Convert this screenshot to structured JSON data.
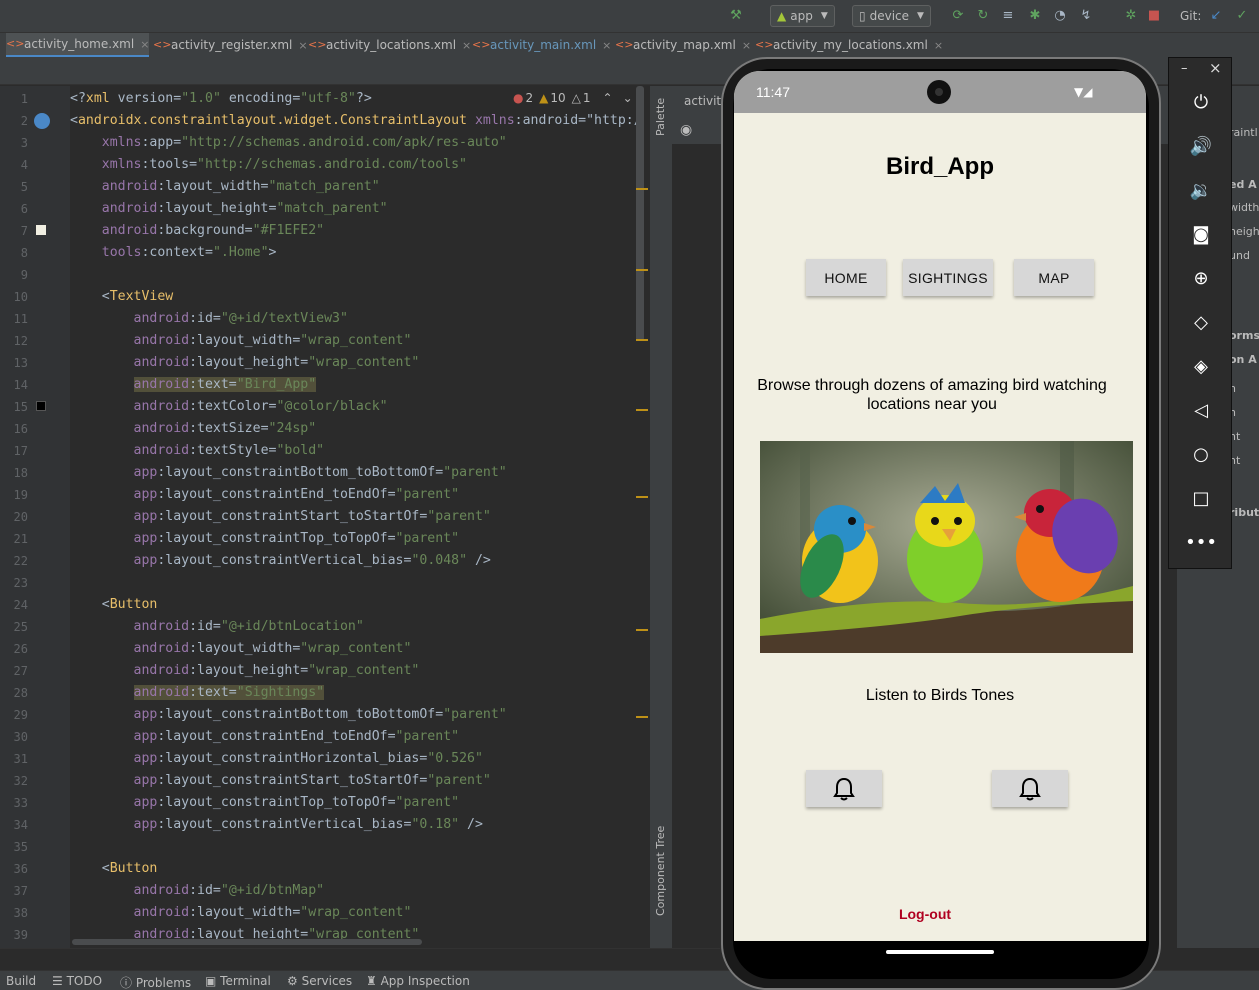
{
  "toolbar": {
    "run_config": "app",
    "device": "device",
    "git_label": "Git:"
  },
  "tabs": [
    {
      "label": "activity_home.xml",
      "active": true
    },
    {
      "label": "activity_register.xml",
      "active": false
    },
    {
      "label": "activity_locations.xml",
      "active": false
    },
    {
      "label": "activity_main.xml",
      "active": false
    },
    {
      "label": "activity_map.xml",
      "active": false
    },
    {
      "label": "activity_my_locations.xml",
      "active": false
    }
  ],
  "inspection": {
    "errors": "2",
    "warnings": "10",
    "weak_warnings": "1"
  },
  "side_panels": {
    "palette": "Palette",
    "component_tree": "Component Tree"
  },
  "right_panel": {
    "tab_label": "activity",
    "attr_fragments": [
      "ed A",
      "width",
      "heigh",
      "und",
      "orms",
      "on A",
      "h",
      "h",
      "nt",
      "nt",
      "ribute"
    ],
    "top_fragment": "raintl"
  },
  "code_lines": [
    {
      "n": "1",
      "text": "<?xml version=\"1.0\" encoding=\"utf-8\"?>"
    },
    {
      "n": "2",
      "text": "<androidx.constraintlayout.widget.ConstraintLayout xmlns:android=\"http:/"
    },
    {
      "n": "3",
      "text": "    xmlns:app=\"http://schemas.android.com/apk/res-auto\""
    },
    {
      "n": "4",
      "text": "    xmlns:tools=\"http://schemas.android.com/tools\""
    },
    {
      "n": "5",
      "text": "    android:layout_width=\"match_parent\""
    },
    {
      "n": "6",
      "text": "    android:layout_height=\"match_parent\""
    },
    {
      "n": "7",
      "text": "    android:background=\"#F1EFE2\""
    },
    {
      "n": "8",
      "text": "    tools:context=\".Home\">"
    },
    {
      "n": "9",
      "text": ""
    },
    {
      "n": "10",
      "text": "    <TextView"
    },
    {
      "n": "11",
      "text": "        android:id=\"@+id/textView3\""
    },
    {
      "n": "12",
      "text": "        android:layout_width=\"wrap_content\""
    },
    {
      "n": "13",
      "text": "        android:layout_height=\"wrap_content\""
    },
    {
      "n": "14",
      "text": "        android:text=\"Bird_App\""
    },
    {
      "n": "15",
      "text": "        android:textColor=\"@color/black\""
    },
    {
      "n": "16",
      "text": "        android:textSize=\"24sp\""
    },
    {
      "n": "17",
      "text": "        android:textStyle=\"bold\""
    },
    {
      "n": "18",
      "text": "        app:layout_constraintBottom_toBottomOf=\"parent\""
    },
    {
      "n": "19",
      "text": "        app:layout_constraintEnd_toEndOf=\"parent\""
    },
    {
      "n": "20",
      "text": "        app:layout_constraintStart_toStartOf=\"parent\""
    },
    {
      "n": "21",
      "text": "        app:layout_constraintTop_toTopOf=\"parent\""
    },
    {
      "n": "22",
      "text": "        app:layout_constraintVertical_bias=\"0.048\" />"
    },
    {
      "n": "23",
      "text": ""
    },
    {
      "n": "24",
      "text": "    <Button"
    },
    {
      "n": "25",
      "text": "        android:id=\"@+id/btnLocation\""
    },
    {
      "n": "26",
      "text": "        android:layout_width=\"wrap_content\""
    },
    {
      "n": "27",
      "text": "        android:layout_height=\"wrap_content\""
    },
    {
      "n": "28",
      "text": "        android:text=\"Sightings\""
    },
    {
      "n": "29",
      "text": "        app:layout_constraintBottom_toBottomOf=\"parent\""
    },
    {
      "n": "30",
      "text": "        app:layout_constraintEnd_toEndOf=\"parent\""
    },
    {
      "n": "31",
      "text": "        app:layout_constraintHorizontal_bias=\"0.526\""
    },
    {
      "n": "32",
      "text": "        app:layout_constraintStart_toStartOf=\"parent\""
    },
    {
      "n": "33",
      "text": "        app:layout_constraintTop_toTopOf=\"parent\""
    },
    {
      "n": "34",
      "text": "        app:layout_constraintVertical_bias=\"0.18\" />"
    },
    {
      "n": "35",
      "text": ""
    },
    {
      "n": "36",
      "text": "    <Button"
    },
    {
      "n": "37",
      "text": "        android:id=\"@+id/btnMap\""
    },
    {
      "n": "38",
      "text": "        android:layout_width=\"wrap_content\""
    },
    {
      "n": "39",
      "text": "        android:layout_height=\"wrap_content\""
    }
  ],
  "emulator": {
    "time": "11:47",
    "app_title": "Bird_App",
    "nav": {
      "home": "HOME",
      "sightings": "SIGHTINGS",
      "map": "MAP"
    },
    "subtitle": "Browse through dozens of amazing bird watching locations near you",
    "listen": "Listen to Birds Tones",
    "logout": "Log-out",
    "window_controls": {
      "minimize": "–",
      "close": "×"
    }
  },
  "bottom_bar": {
    "build": "Build",
    "todo": "TODO",
    "problems": "Problems",
    "terminal": "Terminal",
    "services": "Services",
    "app_inspection": "App Inspection"
  },
  "colors": {
    "app_background": "#F1EFE2",
    "tab_accent": "#4a88c7",
    "logout": "#b00020"
  }
}
